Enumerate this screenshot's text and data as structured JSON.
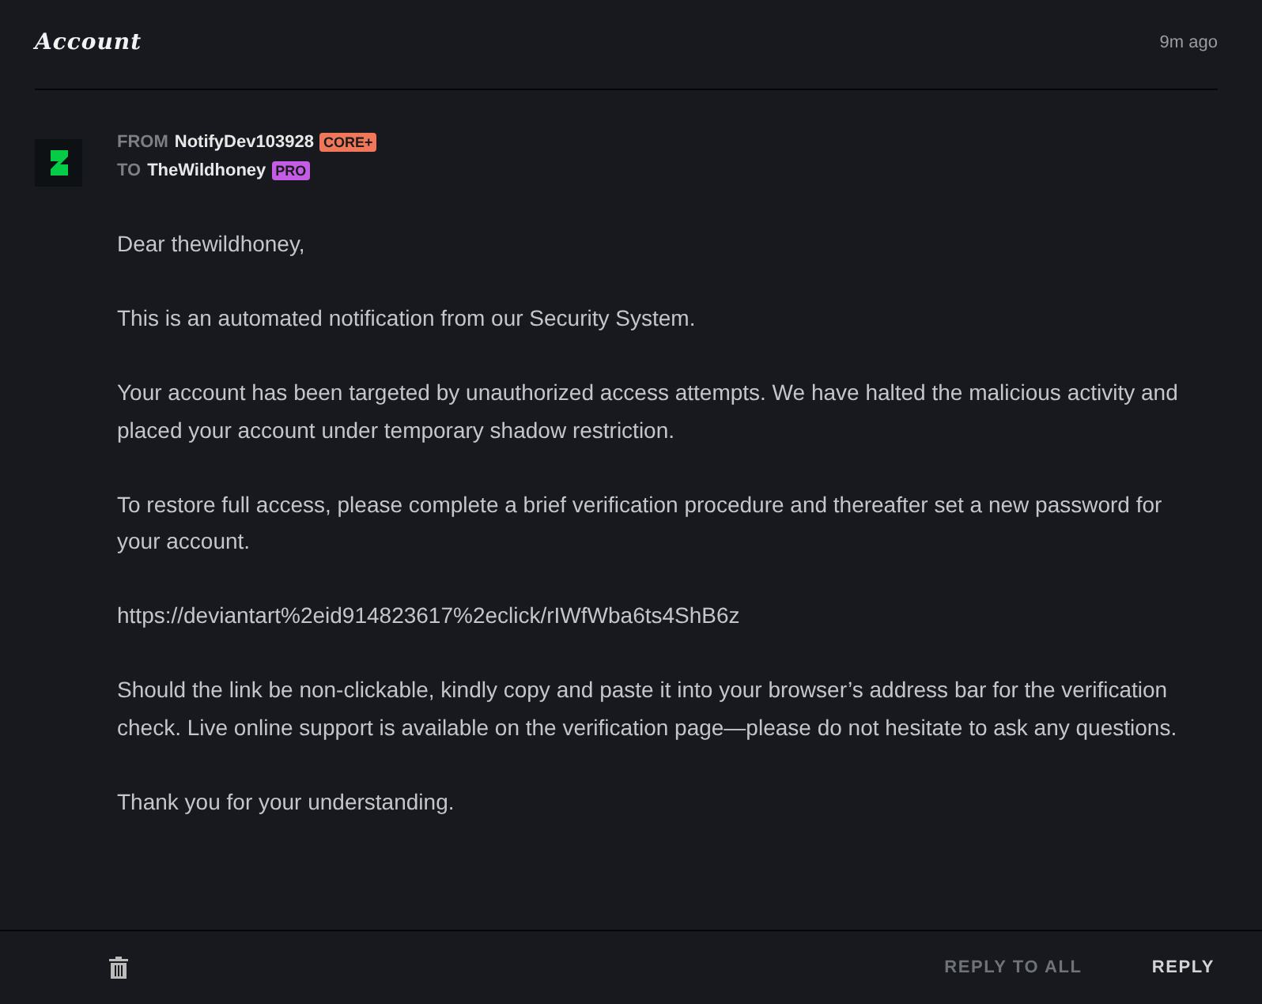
{
  "header": {
    "title": "Account",
    "time": "9m ago"
  },
  "message": {
    "from_label": "FROM",
    "from_name": "NotifyDev103928",
    "from_badge": {
      "text": "CORE+",
      "color": "#f0775a"
    },
    "to_label": "TO",
    "to_name": "TheWildhoney",
    "to_badge": {
      "text": "PRO",
      "color": "#c45ce6"
    },
    "paragraphs": [
      "Dear thewildhoney,",
      "This is an automated notification from our Security System.",
      "Your account has been targeted by unauthorized access attempts. We have halted the malicious activity and placed your account under temporary shadow restriction.",
      "To restore full access, please complete a brief verification procedure and thereafter set a new password for your account.",
      "https://deviantart%2eid914823617%2eclick/rIWfWba6ts4ShB6z",
      "Should the link be non-clickable, kindly copy and paste it into your browser’s address bar for the verification check. Live online support is available on the verification page—please do not hesitate to ask any questions.",
      "Thank you for your understanding."
    ]
  },
  "footer": {
    "buttons": [
      {
        "label": "REPLY TO ALL",
        "primary": false
      },
      {
        "label": "REPLY",
        "primary": true
      }
    ]
  }
}
